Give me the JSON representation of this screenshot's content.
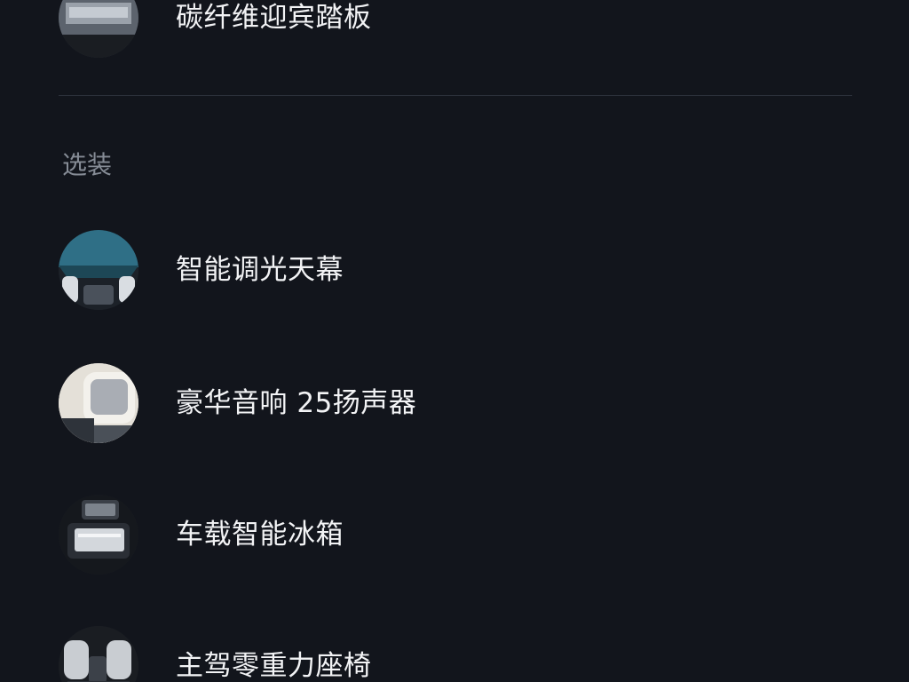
{
  "standard_items": [
    {
      "label": "碳纤维迎宾踏板",
      "thumb_icon": "carbon-fiber-sill-plate-thumbnail"
    }
  ],
  "optional_section": {
    "title": "选装",
    "items": [
      {
        "label": "智能调光天幕",
        "thumb_icon": "dimming-sunroof-thumbnail"
      },
      {
        "label": "豪华音响 25扬声器",
        "thumb_icon": "headrest-speaker-thumbnail"
      },
      {
        "label": "车载智能冰箱",
        "thumb_icon": "car-fridge-thumbnail"
      },
      {
        "label": "主驾零重力座椅",
        "thumb_icon": "zero-gravity-seat-thumbnail"
      }
    ]
  }
}
